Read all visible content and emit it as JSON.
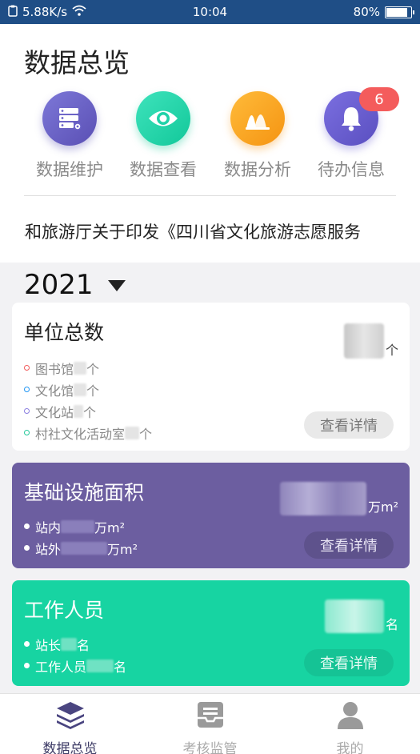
{
  "status_bar": {
    "speed": "5.88K/s",
    "time": "10:04",
    "battery": "80%",
    "battery_level": 0.8
  },
  "page_title": "数据总览",
  "quick_actions": [
    {
      "label": "数据维护",
      "icon": "server-icon",
      "color": "#6a63c8"
    },
    {
      "label": "数据查看",
      "icon": "eye-icon",
      "color": "#1fd2a8"
    },
    {
      "label": "数据分析",
      "icon": "chart-peaks-icon",
      "color": "#f7a21b"
    },
    {
      "label": "待办信息",
      "icon": "bell-icon",
      "color": "#6b5fd6",
      "badge": "6"
    }
  ],
  "notice": "化和旅游厅关于印发《四川省文化旅游志愿服务",
  "year_selector": "2021",
  "cards": {
    "units": {
      "title": "单位总数",
      "total_unit": "个",
      "items": [
        {
          "label": "图书馆",
          "unit": "个",
          "color": "#f25b5b"
        },
        {
          "label": "文化馆",
          "unit": "个",
          "color": "#2196f3"
        },
        {
          "label": "文化站",
          "unit": "个",
          "color": "#8b7fe0"
        },
        {
          "label": "村社文化活动室",
          "unit": "个",
          "color": "#25c99b"
        }
      ],
      "button": "查看详情"
    },
    "area": {
      "title": "基础设施面积",
      "total_unit": "万m²",
      "items": [
        {
          "label": "站内",
          "unit": "万m²"
        },
        {
          "label": "站外",
          "unit": "万m²"
        }
      ],
      "button": "查看详情"
    },
    "staff": {
      "title": "工作人员",
      "total_unit": "名",
      "items": [
        {
          "label": "站长",
          "unit": "名"
        },
        {
          "label": "工作人员",
          "unit": "名"
        }
      ],
      "button": "查看详情"
    }
  },
  "tabbar": [
    {
      "label": "数据总览",
      "icon": "layers-icon",
      "active": true
    },
    {
      "label": "考核监管",
      "icon": "inbox-icon",
      "active": false
    },
    {
      "label": "我的",
      "icon": "user-icon",
      "active": false
    }
  ]
}
